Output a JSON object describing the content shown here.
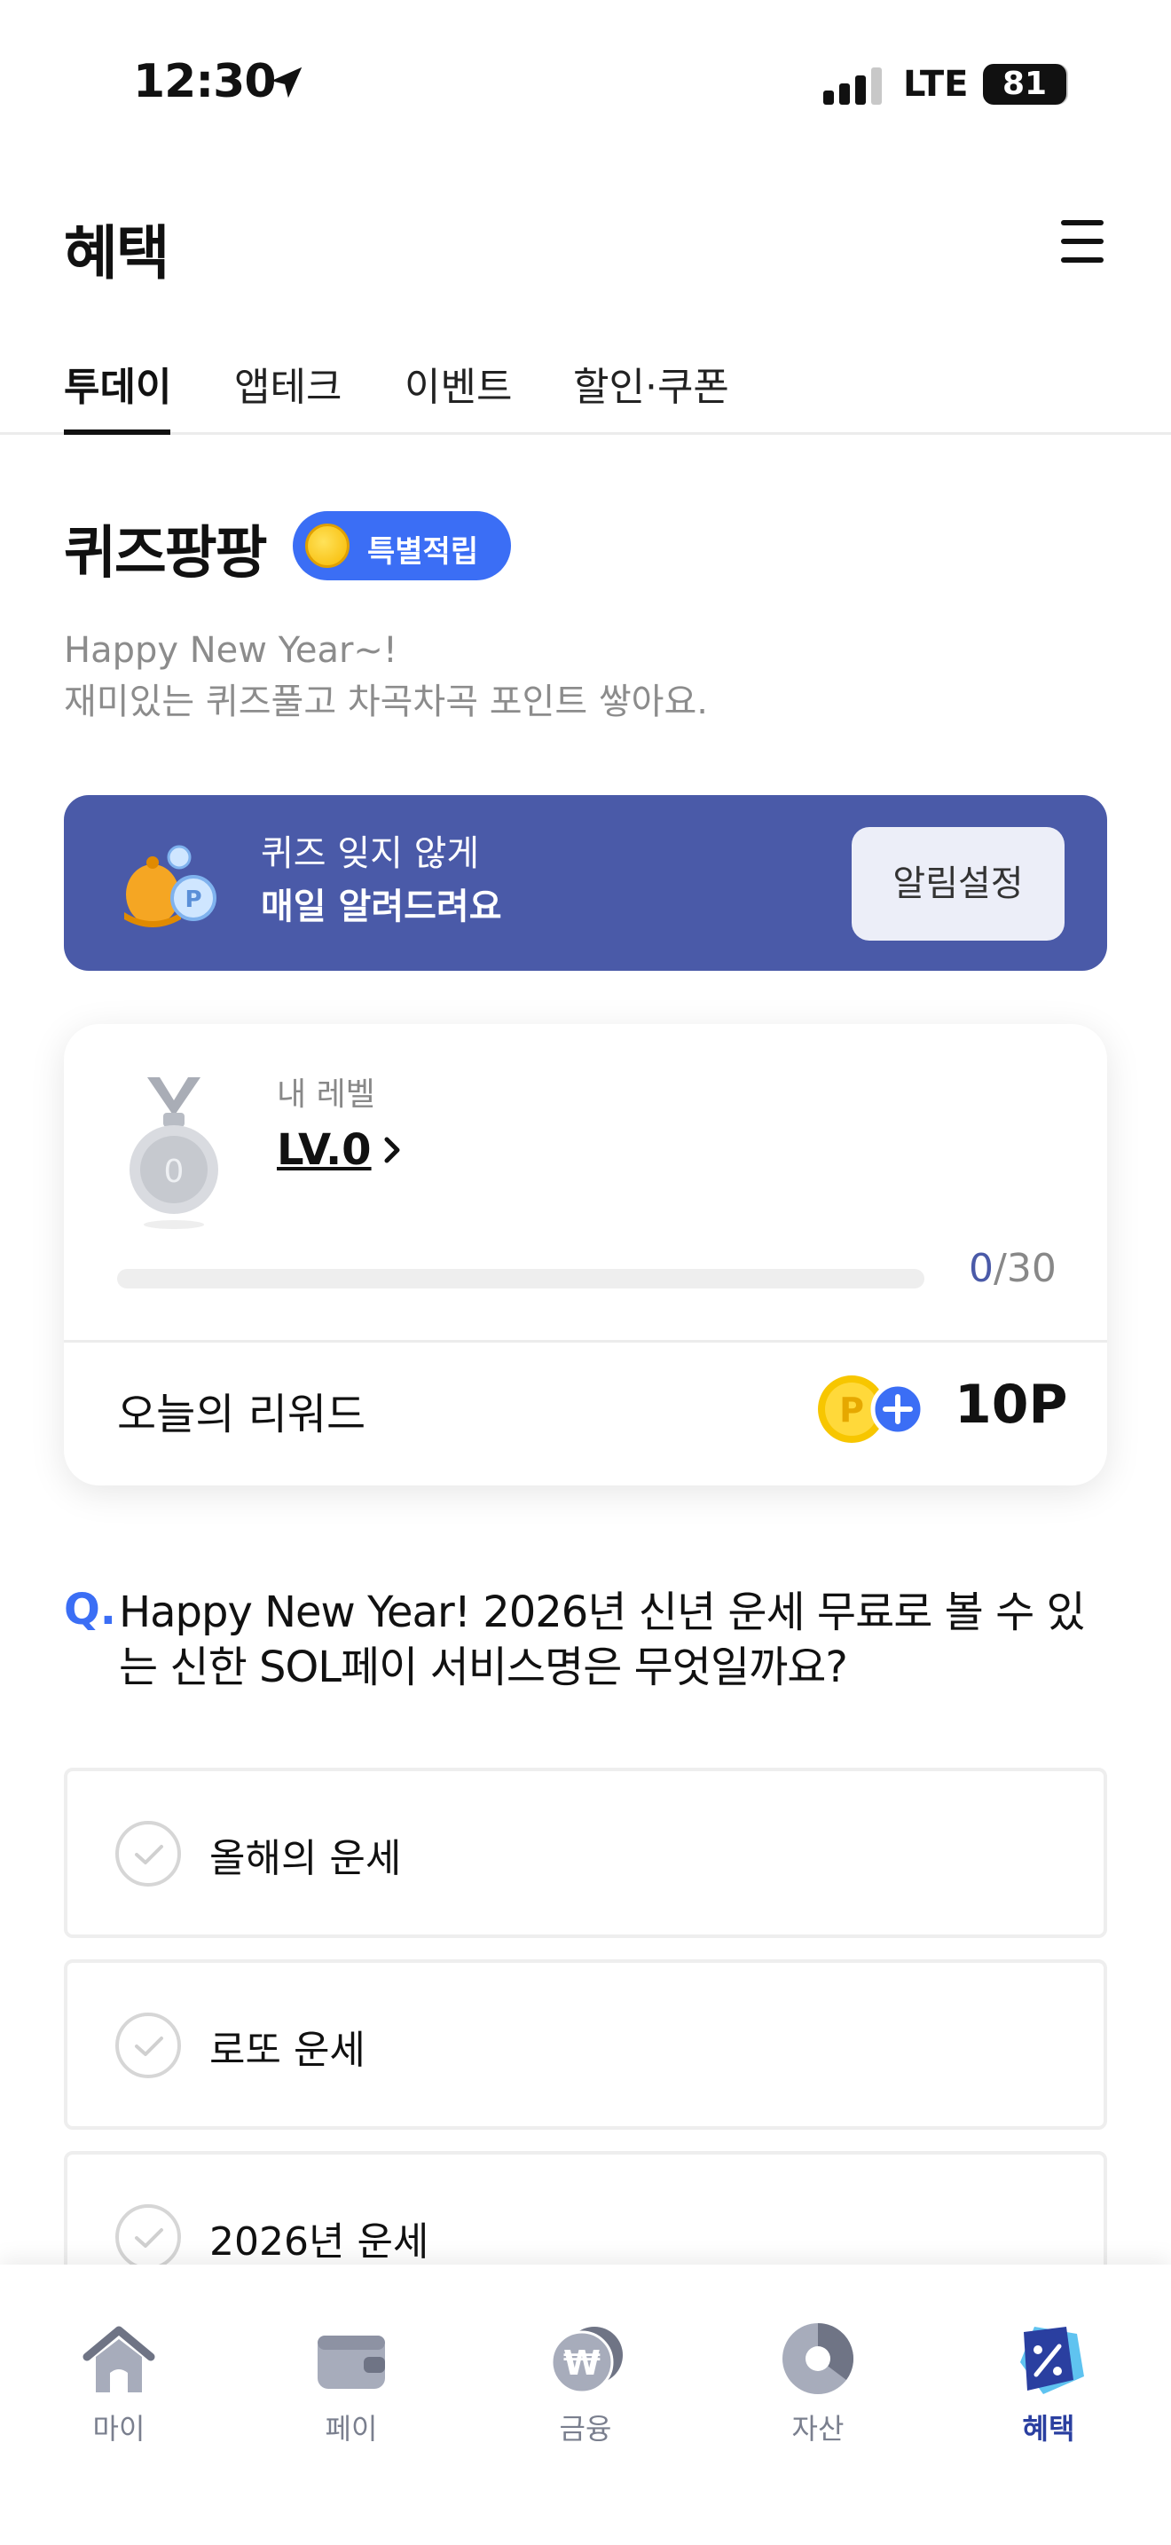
{
  "status_bar": {
    "time": "12:30",
    "network": "LTE",
    "battery": "81"
  },
  "header": {
    "title": "혜택",
    "menu_icon": "hamburger-menu-icon"
  },
  "tabs": [
    {
      "label": "투데이",
      "active": true
    },
    {
      "label": "앱테크",
      "active": false
    },
    {
      "label": "이벤트",
      "active": false
    },
    {
      "label": "할인·쿠폰",
      "active": false
    }
  ],
  "quiz": {
    "title": "퀴즈팡팡",
    "badge": "특별적립",
    "desc_line1": "Happy New Year~!",
    "desc_line2": "재미있는 퀴즈풀고 차곡차곡 포인트 쌓아요."
  },
  "alarm_banner": {
    "line1": "퀴즈 잊지 않게",
    "line2": "매일 알려드려요",
    "button": "알림설정",
    "bg_color": "#4a5aa8"
  },
  "level_card": {
    "my_level_label": "내 레벨",
    "level": "LV.0",
    "medal_number": "0",
    "progress_current": "0",
    "progress_total": "/30",
    "progress_fraction": 0,
    "reward_label": "오늘의 리워드",
    "reward_value": "10P"
  },
  "question": {
    "mark": "Q.",
    "text": "Happy New Year! 2026년 신년 운세 무료로 볼 수 있는 신한 SOL페이 서비스명은 무엇일까요?"
  },
  "options": [
    {
      "label": "올해의 운세"
    },
    {
      "label": "로또 운세"
    },
    {
      "label": "2026년 운세"
    }
  ],
  "bottom_nav": [
    {
      "label": "마이",
      "icon": "home-icon",
      "active": false
    },
    {
      "label": "페이",
      "icon": "wallet-icon",
      "active": false
    },
    {
      "label": "금융",
      "icon": "won-coin-icon",
      "active": false
    },
    {
      "label": "자산",
      "icon": "pie-chart-icon",
      "active": false
    },
    {
      "label": "혜택",
      "icon": "discount-tag-icon",
      "active": true
    }
  ],
  "colors": {
    "accent": "#3b6ef5",
    "active_nav": "#2a3fa0",
    "muted": "#8c8c8c"
  }
}
